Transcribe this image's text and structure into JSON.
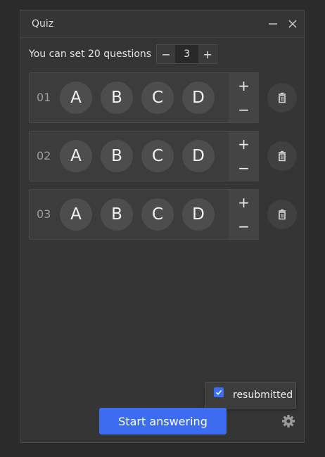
{
  "window": {
    "title": "Quiz",
    "minimize_icon": "minimize-icon",
    "close_icon": "close-icon"
  },
  "settings": {
    "label": "You can set 20 questions",
    "count_value": "3",
    "decrement_label": "−",
    "increment_label": "+"
  },
  "questions": [
    {
      "number": "01",
      "options": [
        "A",
        "B",
        "C",
        "D"
      ],
      "add_label": "+",
      "remove_label": "−"
    },
    {
      "number": "02",
      "options": [
        "A",
        "B",
        "C",
        "D"
      ],
      "add_label": "+",
      "remove_label": "−"
    },
    {
      "number": "03",
      "options": [
        "A",
        "B",
        "C",
        "D"
      ],
      "add_label": "+",
      "remove_label": "−"
    }
  ],
  "popover": {
    "checkbox_checked": true,
    "label": "resubmitted"
  },
  "footer": {
    "start_label": "Start answering",
    "settings_icon": "gear-icon"
  },
  "colors": {
    "accent": "#3c6cf0",
    "window_bg": "#353535",
    "card_bg": "#3c3c3c",
    "option_bg": "#4d4d4d"
  }
}
